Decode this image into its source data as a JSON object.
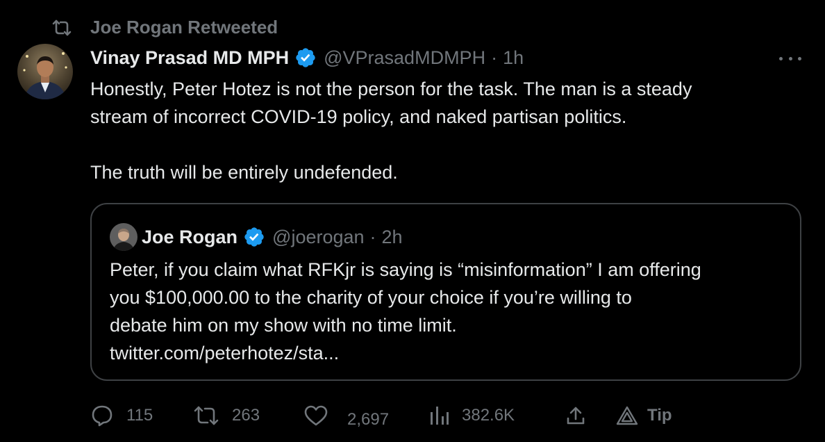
{
  "retweet": {
    "label": "Joe Rogan Retweeted"
  },
  "tweet": {
    "author_name": "Vinay Prasad MD MPH",
    "handle": "@VPrasadMDMPH",
    "separator": "·",
    "time": "1h",
    "verified": true,
    "body_lines": [
      "Honestly, Peter Hotez is not the person for the task. The man is a steady",
      "stream of incorrect COVID-19 policy, and naked partisan politics.",
      "The truth will be entirely undefended."
    ]
  },
  "quote": {
    "author_name": "Joe Rogan",
    "handle": "@joerogan",
    "separator": "·",
    "time": "2h",
    "verified": true,
    "body_lines": [
      "Peter, if you claim what RFKjr is saying is “misinformation” I am offering",
      "you $100,000.00 to the charity of your choice if you’re willing to",
      "debate him on my show with no time limit.",
      "twitter.com/peterhotez/sta..."
    ]
  },
  "actions": {
    "replies": "115",
    "retweets": "263",
    "likes": "2,697",
    "views": "382.6K",
    "tip": "Tip"
  },
  "icons": {
    "retweet": "retweet-icon",
    "verified": "verified-badge-icon",
    "more": "more-icon",
    "reply": "reply-icon",
    "like": "heart-icon",
    "views": "views-icon",
    "share": "share-icon",
    "tip": "tip-icon"
  },
  "colors": {
    "background": "#000000",
    "text": "#e7e9ea",
    "muted": "#71767b",
    "verified_blue": "#1d9bf0",
    "border": "#3e4144"
  }
}
